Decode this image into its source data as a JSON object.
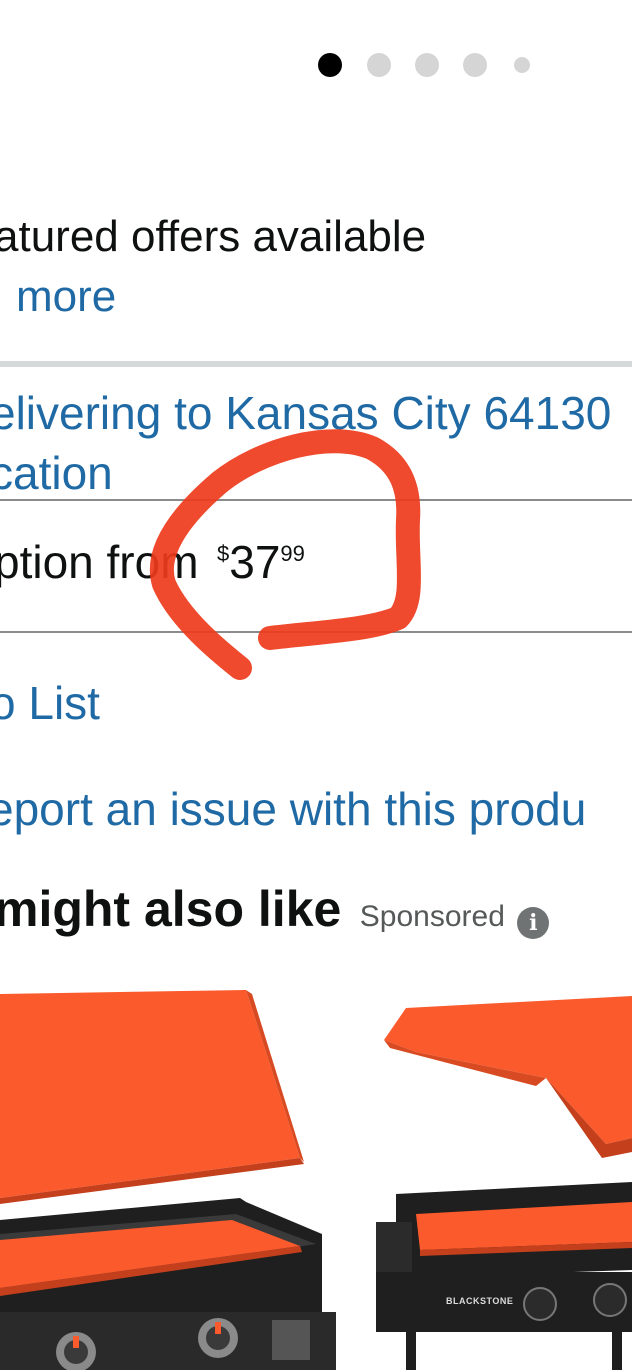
{
  "carousel": {
    "count": 5,
    "active_index": 0
  },
  "offers": {
    "featured_text": "atured offers available",
    "see_more": "more"
  },
  "delivery": {
    "line1": "elivering to Kansas City 64130",
    "line2": "cation"
  },
  "option": {
    "text": "ption from",
    "price_symbol": "$",
    "price_whole": "37",
    "price_fraction": "99"
  },
  "links": {
    "add_to_list": "o List",
    "report_issue": "eport an issue with this produ"
  },
  "recommendations": {
    "title": "might also like",
    "sponsored": "Sponsored",
    "info_icon": "i"
  },
  "products": [
    {
      "brand": ""
    },
    {
      "brand": "BLACKSTONE"
    }
  ],
  "colors": {
    "link": "#1f6aa5",
    "annotation": "#ee3b1c",
    "cover": "#fb5a2c"
  }
}
